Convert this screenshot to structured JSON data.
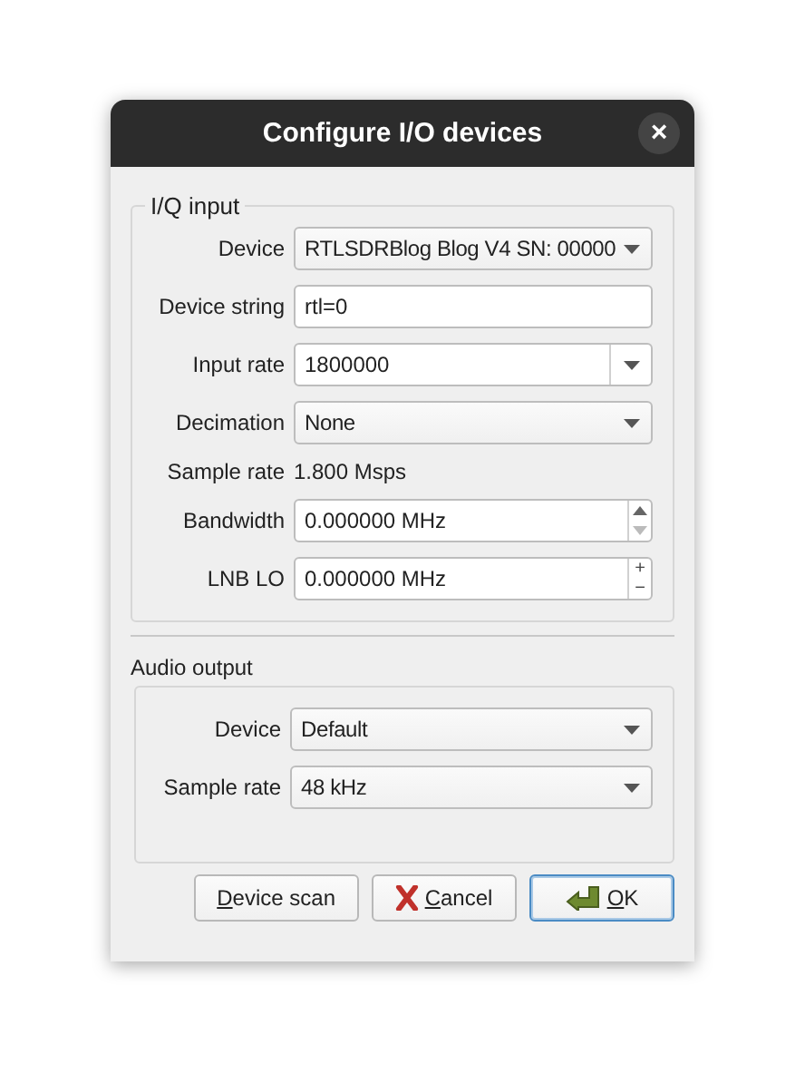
{
  "window": {
    "title": "Configure I/O devices",
    "close": "×"
  },
  "iq_input": {
    "title": "I/Q input",
    "rows": [
      {
        "label": "Device",
        "kind": "combo",
        "value": "RTLSDRBlog Blog V4 SN: 00000"
      },
      {
        "label": "Device string",
        "kind": "text",
        "value": "rtl=0"
      },
      {
        "label": "Input rate",
        "kind": "editable-combo",
        "value": "1800000"
      },
      {
        "label": "Decimation",
        "kind": "combo",
        "value": "None"
      },
      {
        "label": "Sample rate",
        "kind": "readout",
        "value": "1.800 Msps"
      },
      {
        "label": "Bandwidth",
        "kind": "spin-arrows",
        "value": "0.000000 MHz"
      },
      {
        "label": "LNB LO",
        "kind": "spin-plusminus",
        "value": "0.000000 MHz",
        "up": "+",
        "down": "−"
      }
    ]
  },
  "audio_output": {
    "title": "Audio output",
    "rows": [
      {
        "label": "Device",
        "kind": "combo",
        "value": "Default"
      },
      {
        "label": "Sample rate",
        "kind": "combo",
        "value": "48 kHz"
      }
    ]
  },
  "buttons": [
    {
      "label": "Device scan",
      "kind": "plain",
      "default": false,
      "mnemonic_first": true
    },
    {
      "label": "Cancel",
      "kind": "cancel",
      "default": false,
      "mnemonic_first": true
    },
    {
      "label": "OK",
      "kind": "accept",
      "default": true,
      "mnemonic_first": true
    }
  ]
}
